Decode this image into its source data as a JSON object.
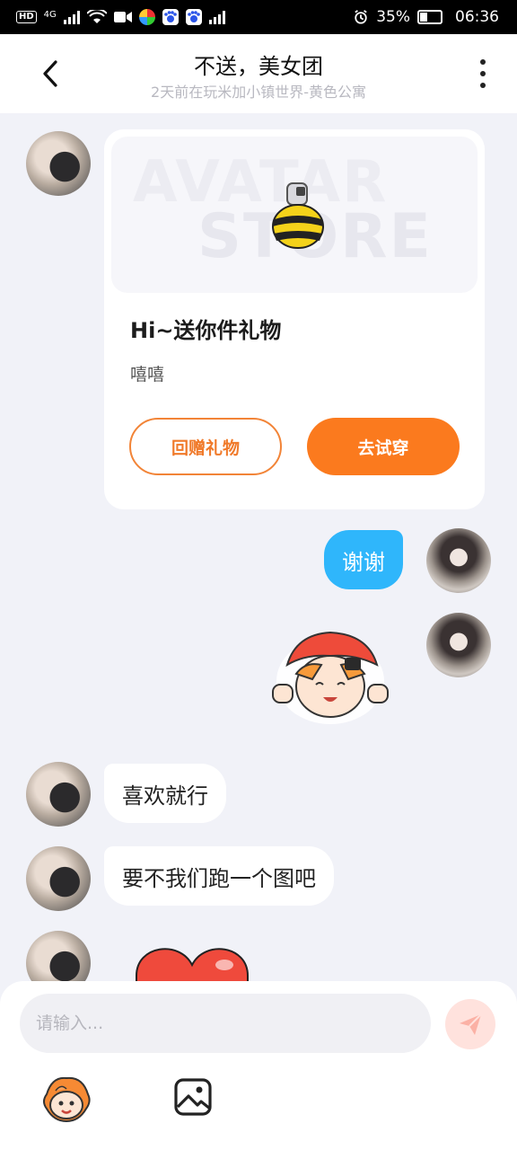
{
  "status_bar": {
    "network": "4G",
    "battery": "35%",
    "time": "06:36"
  },
  "header": {
    "title": "不送，美女团",
    "subtitle": "2天前在玩米加小镇世界-黄色公寓"
  },
  "messages": {
    "gift_card": {
      "banner_word_1": "AVATAR",
      "banner_word_2": "STORE",
      "title": "Hi~送你件礼物",
      "text": "嘻嘻",
      "return_label": "回赠礼物",
      "try_label": "去试穿"
    },
    "reply_thanks": "谢谢",
    "msg_like": "喜欢就行",
    "msg_map": "要不我们跑一个图吧"
  },
  "input": {
    "placeholder": "请输入..."
  },
  "colors": {
    "accent_orange": "#fb7a1e",
    "bubble_blue": "#2fb6fb",
    "background": "#f1f2f8"
  },
  "icons": [
    "back-icon",
    "more-icon",
    "send-icon",
    "emoji-icon",
    "image-icon",
    "bee-icon"
  ]
}
